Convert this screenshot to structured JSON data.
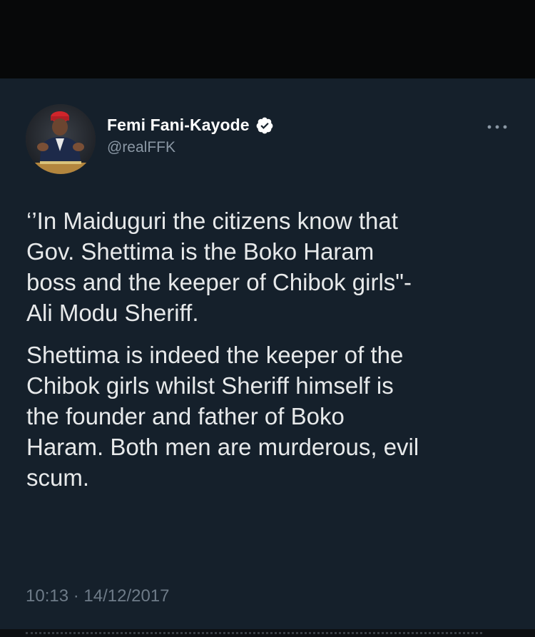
{
  "author": {
    "name": "Femi Fani-Kayode",
    "handle": "@realFFK",
    "verified_icon": "verified-badge-icon",
    "avatar_icon": "profile-photo-avatar"
  },
  "menu": {
    "icon": "more-options-icon"
  },
  "tweet": {
    "paragraphs": [
      "‘’In Maiduguri the citizens know that\nGov. Shettima is the Boko Haram\nboss and the keeper of Chibok girls\"-\nAli Modu Sheriff.",
      "Shettima is indeed the keeper of the\nChibok girls whilst Sheriff himself is\nthe founder and father of Boko\nHaram. Both men are murderous, evil\nscum."
    ],
    "timestamp": "10:13 · 14/12/2017"
  },
  "colors": {
    "background": "#15202b",
    "top_bar": "#070809",
    "text": "#e7e9ea",
    "secondary_text": "#8b98a5",
    "verified": "#ffffff"
  }
}
